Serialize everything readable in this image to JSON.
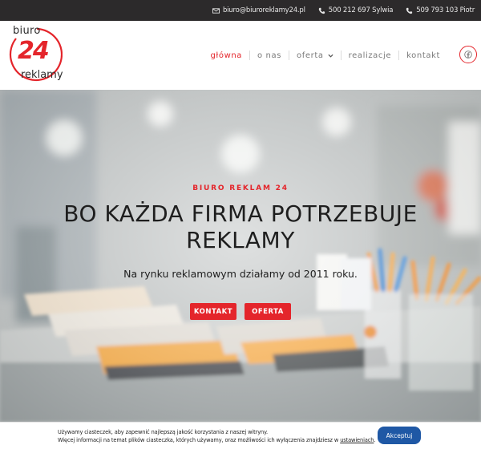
{
  "topbar": {
    "email": "biuro@biuroreklamy24.pl",
    "phone1": "500 212 697 Sylwia",
    "phone2": "509 793 103 Piotr"
  },
  "logo": {
    "word_top": "biuro",
    "number": "24",
    "word_bottom": "reklamy"
  },
  "nav": {
    "items": [
      {
        "label": "główna",
        "active": true
      },
      {
        "label": "o nas"
      },
      {
        "label": "oferta",
        "has_dropdown": true
      },
      {
        "label": "realizacje"
      },
      {
        "label": "kontakt"
      }
    ],
    "social_icon": "facebook-icon"
  },
  "hero": {
    "kicker": "BIURO REKLAM 24",
    "title": "BO KAŻDA FIRMA POTRZEBUJE REKLAMY",
    "subtitle": "Na rynku reklamowym działamy od 2011 roku.",
    "btn_contact": "KONTAKT",
    "btn_offer": "OFERTA"
  },
  "cookie": {
    "line1": "Używamy ciasteczek, aby zapewnić najlepszą jakość korzystania z naszej witryny.",
    "line2_prefix": "Więcej informacji na temat plików ciasteczka, których używamy, oraz możliwości ich wyłączenia znajdziesz w ",
    "link": "ustawieniach",
    "line2_suffix": ".",
    "accept": "Akceptuj"
  },
  "colors": {
    "accent": "#e4252b",
    "topbar_bg": "#2c2a2b",
    "cookie_button": "#1f58a5"
  }
}
